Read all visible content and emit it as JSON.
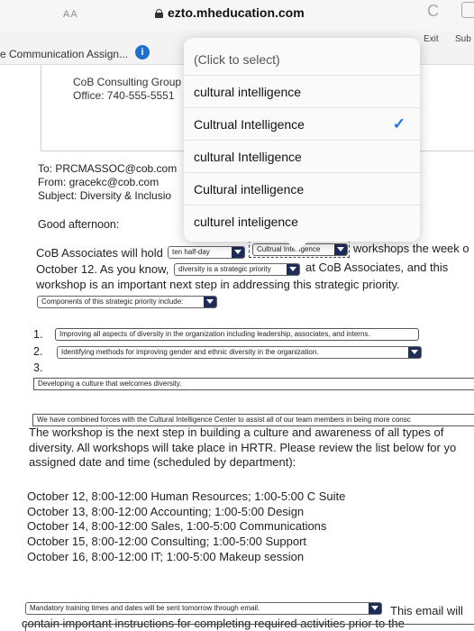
{
  "browser": {
    "text_size_label": "AA",
    "url": "ezto.mheducation.com",
    "reload_symbol": "C"
  },
  "assignment": {
    "title": "e Communication Assign...",
    "info_symbol": "i",
    "exit_label": "Exit",
    "submit_label": "Sub"
  },
  "email": {
    "signature_line1": "CoB Consulting Group",
    "signature_line2": "Office: 740-555-5551",
    "to": "To: PRCMASSOC@cob.com",
    "from": "From: gracekc@cob.com",
    "subject": "Subject: Diversity & Inclusio",
    "greeting": "Good afternoon:"
  },
  "dropdown": {
    "placeholder": "(Click to select)",
    "options": [
      {
        "label": "cultural intelligence",
        "selected": false
      },
      {
        "label": "Cultrual Intelligence",
        "selected": true
      },
      {
        "label": "cultural Intelligence",
        "selected": false
      },
      {
        "label": "Cultural intelligence",
        "selected": false
      },
      {
        "label": "culturel inteligence",
        "selected": false
      }
    ],
    "check_symbol": "✓"
  },
  "paragraph": {
    "line1_start": "CoB Associates will hold",
    "select1": "ten half-day",
    "select2": "Cultrual Intelligence",
    "line1_end": "workshops the week o",
    "line2_start": "October 12. As you know,",
    "select3": "diversity is a strategic priority",
    "line2_end": "at CoB Associates, and this",
    "line3": "workshop is an important next step in addressing this strategic priority.",
    "select4": "Components of this strategic priority include:"
  },
  "list": {
    "items": [
      {
        "number": "1.",
        "value": "Improving all aspects of diversity in the organization including leadership, associates, and interns."
      },
      {
        "number": "2.",
        "value": "Identifying methods for improving gender and ethnic diversity in the organization."
      },
      {
        "number": "3.",
        "value": "Developing a culture that welcomes diversity."
      }
    ]
  },
  "body": {
    "combined_box": "We have combined forces with the Cultural Intelligence Center to assist all of our team members in being more consc",
    "line1": "The workshop is the next step in building a culture and awareness of all types of",
    "line2": "diversity. All workshops will take place in HRTR. Please review the list below for yo",
    "line3": "assigned date and time (scheduled by department):"
  },
  "schedule": [
    "October 12, 8:00-12:00 Human Resources; 1:00-5:00 C Suite",
    "October 13, 8:00-12:00 Accounting; 1:00-5:00 Design",
    "October 14, 8:00-12:00 Sales, 1:00-5:00 Communications",
    "October 15, 8:00-12:00 Consulting; 1:00-5:00 Support",
    "October 16, 8:00-12:00 IT; 1:00-5:00 Makeup session"
  ],
  "footer": {
    "select": "Mandatory training times and dates will be sent tomorrow through email.",
    "trailing": "This email will",
    "line": "contain important instructions for completing required activities prior to the"
  }
}
